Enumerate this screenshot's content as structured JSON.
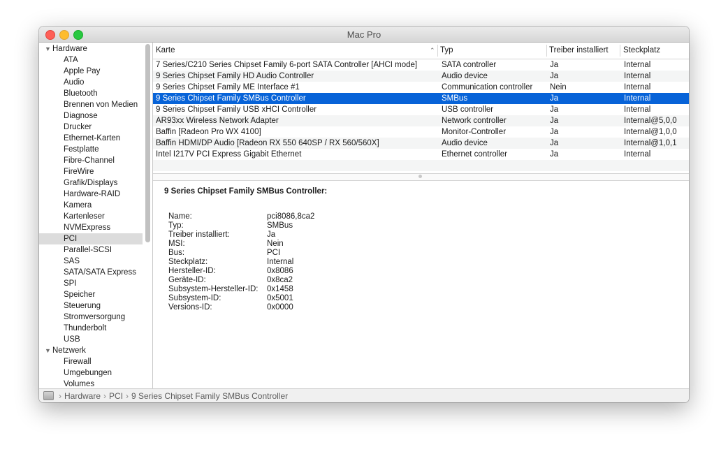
{
  "window": {
    "title": "Mac Pro"
  },
  "sidebar": {
    "groups": [
      {
        "label": "Hardware",
        "items": [
          "ATA",
          "Apple Pay",
          "Audio",
          "Bluetooth",
          "Brennen von Medien",
          "Diagnose",
          "Drucker",
          "Ethernet-Karten",
          "Festplatte",
          "Fibre-Channel",
          "FireWire",
          "Grafik/Displays",
          "Hardware-RAID",
          "Kamera",
          "Kartenleser",
          "NVMExpress",
          "PCI",
          "Parallel-SCSI",
          "SAS",
          "SATA/SATA Express",
          "SPI",
          "Speicher",
          "Steuerung",
          "Stromversorgung",
          "Thunderbolt",
          "USB"
        ]
      },
      {
        "label": "Netzwerk",
        "items": [
          "Firewall",
          "Umgebungen",
          "Volumes"
        ]
      }
    ],
    "selected": "PCI"
  },
  "table": {
    "headers": [
      "Karte",
      "Typ",
      "Treiber installiert",
      "Steckplatz"
    ],
    "sorted_column": "Karte",
    "rows": [
      [
        "7 Series/C210 Series Chipset Family 6-port SATA Controller [AHCI mode]",
        "SATA controller",
        "Ja",
        "Internal"
      ],
      [
        "9 Series Chipset Family HD Audio Controller",
        "Audio device",
        "Ja",
        "Internal"
      ],
      [
        "9 Series Chipset Family ME Interface #1",
        "Communication controller",
        "Nein",
        "Internal"
      ],
      [
        "9 Series Chipset Family SMBus Controller",
        "SMBus",
        "Ja",
        "Internal"
      ],
      [
        "9 Series Chipset Family USB xHCI Controller",
        "USB controller",
        "Ja",
        "Internal"
      ],
      [
        "AR93xx Wireless Network Adapter",
        "Network controller",
        "Ja",
        "Internal@5,0,0"
      ],
      [
        "Baffin [Radeon Pro WX 4100]",
        "Monitor-Controller",
        "Ja",
        "Internal@1,0,0"
      ],
      [
        "Baffin HDMI/DP Audio [Radeon RX 550 640SP / RX 560/560X]",
        "Audio device",
        "Ja",
        "Internal@1,0,1"
      ],
      [
        "Intel I217V PCI Express Gigabit Ethernet",
        "Ethernet controller",
        "Ja",
        "Internal"
      ]
    ],
    "selected_row": 3
  },
  "detail": {
    "title": "9 Series Chipset Family SMBus Controller:",
    "fields": [
      [
        "Name:",
        "pci8086,8ca2"
      ],
      [
        "Typ:",
        "SMBus"
      ],
      [
        "Treiber installiert:",
        "Ja"
      ],
      [
        "MSI:",
        "Nein"
      ],
      [
        "Bus:",
        "PCI"
      ],
      [
        "Steckplatz:",
        "Internal"
      ],
      [
        "Hersteller-ID:",
        "0x8086"
      ],
      [
        "Geräte-ID:",
        "0x8ca2"
      ],
      [
        "Subsystem-Hersteller-ID:",
        "0x1458"
      ],
      [
        "Subsystem-ID:",
        "0x5001"
      ],
      [
        "Versions-ID:",
        "0x0000"
      ]
    ]
  },
  "statusbar": {
    "breadcrumb": [
      "Hardware",
      "PCI",
      "9 Series Chipset Family SMBus Controller"
    ],
    "separator": "›"
  },
  "colors": {
    "selection": "#0763d8",
    "sidebar_selection": "#dcdcdc"
  }
}
